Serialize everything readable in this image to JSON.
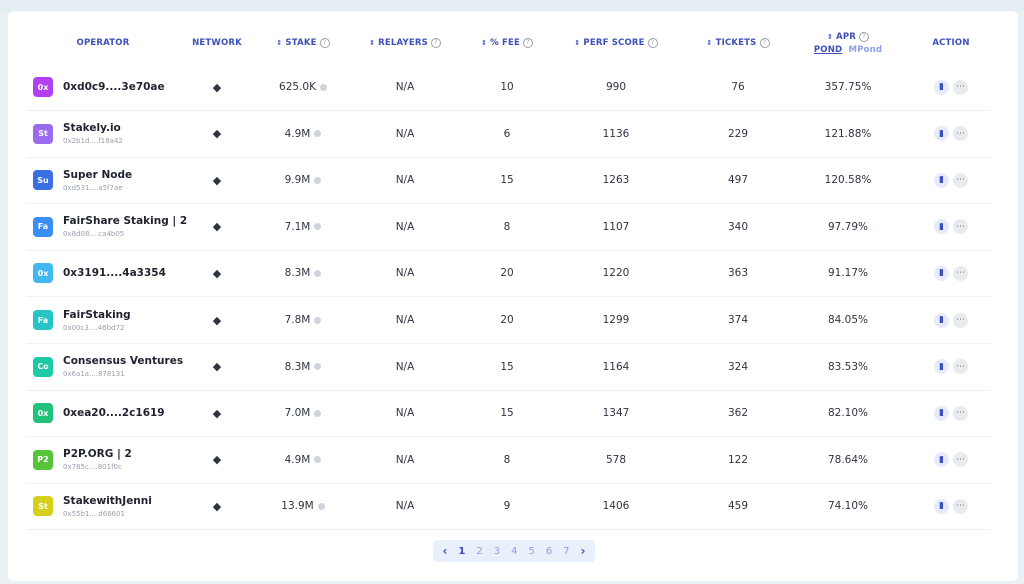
{
  "columns": {
    "operator": "OPERATOR",
    "network": "NETWORK",
    "stake": "STAKE",
    "relayers": "RELAYERS",
    "fee": "% FEE",
    "perf": "PERF SCORE",
    "tickets": "TICKETS",
    "apr": "APR",
    "apr_pond": "POND",
    "apr_mpond": "MPond",
    "action": "ACTION"
  },
  "icons": {
    "sort": "sort-arrows-icon",
    "help": "help-circle-icon",
    "network": "ethereum-icon",
    "coin": "coin-icon",
    "chart": "bar-chart-icon",
    "share": "share-icon"
  },
  "rows": [
    {
      "avatar": "0x",
      "color": "#b23ff0",
      "name": "0xd0c9....3e70ae",
      "addr": "",
      "stake": "625.0K",
      "relayers": "N/A",
      "fee": "10",
      "perf": "990",
      "tickets": "76",
      "apr": "357.75%"
    },
    {
      "avatar": "St",
      "color": "#9b6bef",
      "name": "Stakely.io",
      "addr": "0x2b1d....f18a42",
      "stake": "4.9M",
      "relayers": "N/A",
      "fee": "6",
      "perf": "1136",
      "tickets": "229",
      "apr": "121.88%"
    },
    {
      "avatar": "Su",
      "color": "#3a6fe4",
      "name": "Super Node",
      "addr": "0xd531....a5f7ae",
      "stake": "9.9M",
      "relayers": "N/A",
      "fee": "15",
      "perf": "1263",
      "tickets": "497",
      "apr": "120.58%"
    },
    {
      "avatar": "Fa",
      "color": "#3b8ef5",
      "name": "FairShare Staking | 2",
      "addr": "0x8d08....ca4b05",
      "stake": "7.1M",
      "relayers": "N/A",
      "fee": "8",
      "perf": "1107",
      "tickets": "340",
      "apr": "97.79%"
    },
    {
      "avatar": "0x",
      "color": "#42b8f0",
      "name": "0x3191....4a3354",
      "addr": "",
      "stake": "8.3M",
      "relayers": "N/A",
      "fee": "20",
      "perf": "1220",
      "tickets": "363",
      "apr": "91.17%"
    },
    {
      "avatar": "Fa",
      "color": "#27c4c6",
      "name": "FairStaking",
      "addr": "0x00c3....46bd72",
      "stake": "7.8M",
      "relayers": "N/A",
      "fee": "20",
      "perf": "1299",
      "tickets": "374",
      "apr": "84.05%"
    },
    {
      "avatar": "Co",
      "color": "#1ec9a6",
      "name": "Consensus Ventures",
      "addr": "0x6a1a....878131",
      "stake": "8.3M",
      "relayers": "N/A",
      "fee": "15",
      "perf": "1164",
      "tickets": "324",
      "apr": "83.53%"
    },
    {
      "avatar": "0x",
      "color": "#21c27c",
      "name": "0xea20....2c1619",
      "addr": "",
      "stake": "7.0M",
      "relayers": "N/A",
      "fee": "15",
      "perf": "1347",
      "tickets": "362",
      "apr": "82.10%"
    },
    {
      "avatar": "P2",
      "color": "#55c43b",
      "name": "P2P.ORG | 2",
      "addr": "0x785c....801f0c",
      "stake": "4.9M",
      "relayers": "N/A",
      "fee": "8",
      "perf": "578",
      "tickets": "122",
      "apr": "78.64%"
    },
    {
      "avatar": "St",
      "color": "#d6cf1e",
      "name": "StakewithJenni",
      "addr": "0x55b1....d66601",
      "stake": "13.9M",
      "relayers": "N/A",
      "fee": "9",
      "perf": "1406",
      "tickets": "459",
      "apr": "74.10%"
    }
  ],
  "pagination": {
    "prev": "‹",
    "next": "›",
    "pages": [
      "1",
      "2",
      "3",
      "4",
      "5",
      "6",
      "7"
    ],
    "current": "1"
  }
}
